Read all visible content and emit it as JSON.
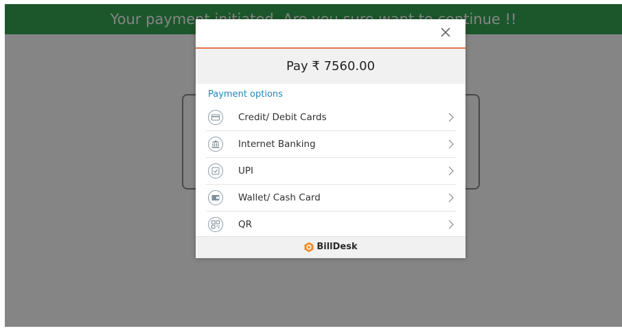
{
  "banner": {
    "text": "Your payment initiated. Are you sure want to continue !!"
  },
  "modal": {
    "close_icon": "close-icon",
    "pay_label": "Pay ₹ 7560.00",
    "section_title": "Payment options",
    "options": [
      {
        "label": "Credit/ Debit Cards",
        "icon": "card-icon"
      },
      {
        "label": "Internet Banking",
        "icon": "bank-icon"
      },
      {
        "label": "UPI",
        "icon": "upi-icon"
      },
      {
        "label": "Wallet/ Cash Card",
        "icon": "wallet-icon"
      },
      {
        "label": "QR",
        "icon": "qr-icon"
      }
    ],
    "footer_brand": "BillDesk"
  },
  "colors": {
    "banner_green": "#34a853",
    "header_accent": "#e8704c",
    "section_title_blue": "#1f87b9",
    "brand_orange": "#f08a24"
  }
}
